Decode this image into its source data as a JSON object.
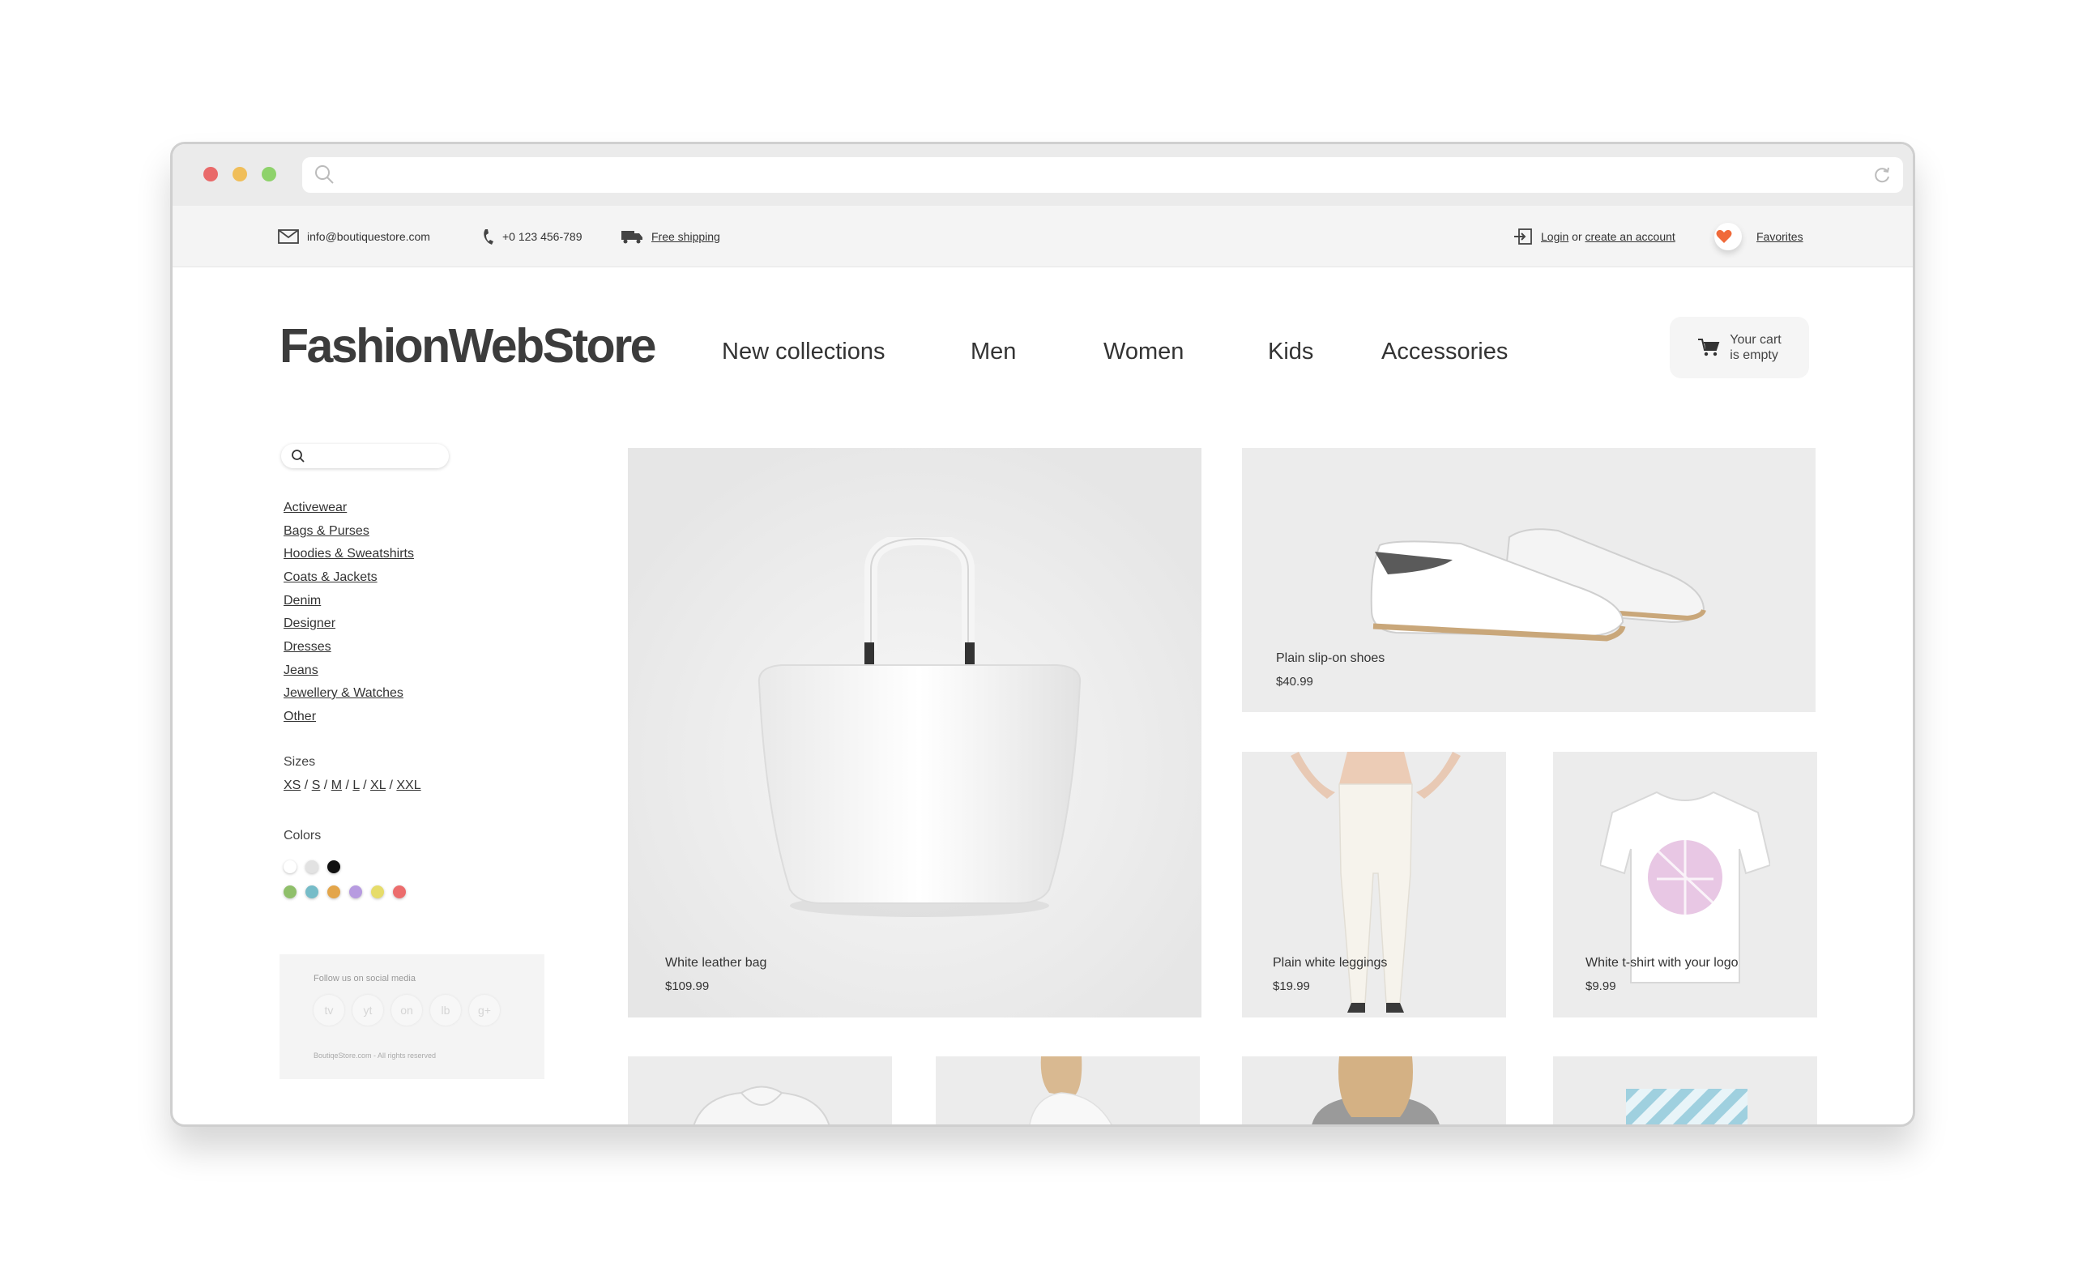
{
  "topbar": {
    "email": "info@boutiquestore.com",
    "phone": "+0 123 456-789",
    "shipping": "Free shipping",
    "login": "Login",
    "login_or": " or ",
    "create_account": "create an account",
    "favorites": "Favorites"
  },
  "header": {
    "logo": "FashionWebStore",
    "nav": [
      "New collections",
      "Men",
      "Women",
      "Kids",
      "Accessories"
    ],
    "cart_line1": "Your cart",
    "cart_line2": "is empty"
  },
  "sidebar": {
    "search_placeholder": "",
    "categories": [
      "Activewear",
      "Bags & Purses",
      "Hoodies & Sweatshirts",
      "Coats & Jackets",
      "Denim",
      "Designer",
      "Dresses",
      "Jeans",
      "Jewellery & Watches",
      "Other"
    ],
    "sizes_label": "Sizes",
    "sizes": [
      "XS",
      "S",
      "M",
      "L",
      "XL",
      "XXL"
    ],
    "colors_label": "Colors",
    "colors_row1": [
      "#ffffff",
      "#e2e2e2",
      "#111111"
    ],
    "colors_row2": [
      "#8fbf6a",
      "#76bcc8",
      "#e3a54a",
      "#b79be0",
      "#e6dc6a",
      "#ec6d6d"
    ],
    "social": {
      "title": "Follow us on social media",
      "buttons": [
        "tv",
        "yt",
        "on",
        "lb",
        "g+"
      ],
      "copyright": "BoutiqeStore.com - All rights reserved"
    }
  },
  "products": [
    {
      "name": "White leather bag",
      "price": "$109.99"
    },
    {
      "name": "Plain slip-on shoes",
      "price": "$40.99"
    },
    {
      "name": "Plain white leggings",
      "price": "$19.99"
    },
    {
      "name": "White t-shirt with your logo",
      "price": "$9.99"
    }
  ],
  "colors": {
    "accent_heart": "#f06a3a",
    "card_bg": "#ececec"
  }
}
